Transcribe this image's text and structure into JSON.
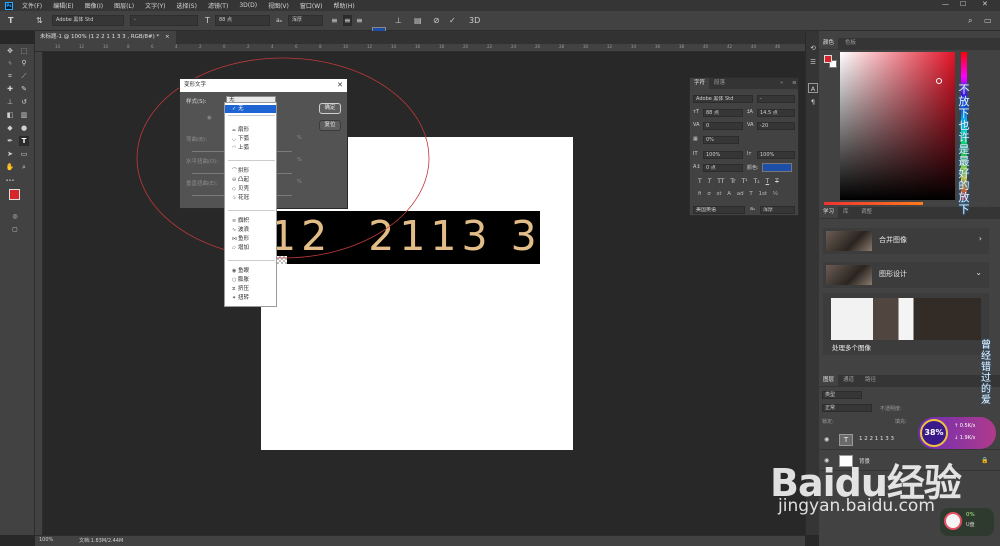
{
  "menubar": {
    "logo": "Ps",
    "items": [
      "文件(F)",
      "编辑(E)",
      "图像(I)",
      "图层(L)",
      "文字(Y)",
      "选择(S)",
      "滤镜(T)",
      "3D(D)",
      "视图(V)",
      "窗口(W)",
      "帮助(H)"
    ],
    "minimize": "—",
    "maximize": "☐",
    "close": "✕"
  },
  "options": {
    "font_family": "Adobe 黑体 Std",
    "font_style": "-",
    "font_size": "88 点",
    "antialias": "浑厚"
  },
  "document": {
    "tab_title": "未标题-1 @ 100% (1 2    2 1 1  3 3 , RGB/8#) *",
    "text_layer_content": "12  2113 3"
  },
  "ruler": {
    "top_numbers": [
      "14",
      "12",
      "10",
      "8",
      "6",
      "4",
      "2",
      "0",
      "2",
      "4",
      "6",
      "8",
      "10",
      "12",
      "14",
      "16",
      "18",
      "20",
      "22",
      "24",
      "26",
      "28",
      "30",
      "32",
      "34",
      "36",
      "38",
      "40",
      "42",
      "44",
      "46"
    ]
  },
  "statusbar": {
    "zoom": "100%",
    "doc_info": "文档:1.83M/2.44M"
  },
  "warp_dialog": {
    "title": "变形文字",
    "style_label": "样式(S):",
    "style_value": "无",
    "ok": "确定",
    "reset": "复位",
    "horizontal": "水平(H)",
    "vertical": "垂直(V)",
    "bend_label": "弯曲(B):",
    "hdist_label": "水平扭曲(O):",
    "vdist_label": "垂直扭曲(E):",
    "percent": "%",
    "style_options": [
      {
        "label": "无",
        "glyph": "✓"
      },
      {
        "label": "扇形",
        "glyph": "⌓"
      },
      {
        "label": "下弧",
        "glyph": "◡"
      },
      {
        "label": "上弧",
        "glyph": "◠"
      },
      {
        "label": "拱形",
        "glyph": "⌒"
      },
      {
        "label": "凸起",
        "glyph": "⊖"
      },
      {
        "label": "贝壳",
        "glyph": "◇"
      },
      {
        "label": "花冠",
        "glyph": "♧"
      },
      {
        "label": "旗帜",
        "glyph": "≋"
      },
      {
        "label": "波浪",
        "glyph": "∿"
      },
      {
        "label": "鱼形",
        "glyph": "⋈"
      },
      {
        "label": "增加",
        "glyph": "▱"
      },
      {
        "label": "鱼眼",
        "glyph": "◉"
      },
      {
        "label": "膨胀",
        "glyph": "○"
      },
      {
        "label": "挤压",
        "glyph": "⧖"
      },
      {
        "label": "扭转",
        "glyph": "✦"
      }
    ]
  },
  "char_panel": {
    "tab_char": "字符",
    "tab_para": "段落",
    "font_family": "Adobe 黑体 Std",
    "font_style": "-",
    "size": "88 点",
    "leading": "14.5 点",
    "kerning": "0",
    "tracking": "-20",
    "scale_pct": "0%",
    "vscale": "100%",
    "hscale": "100%",
    "baseline": "0 点",
    "color_label": "颜色:",
    "lang": "美国英语",
    "aa": "浑厚",
    "styles": [
      "T",
      "T",
      "TT",
      "Tr",
      "T¹",
      "T₁",
      "T",
      "T"
    ],
    "features": [
      "fi",
      "σ",
      "st",
      "A",
      "ad",
      "T",
      "1st",
      "½"
    ]
  },
  "panels": {
    "color_tab": "颜色",
    "swatches_tab": "色板",
    "learn_tab": "学习",
    "lib_tab": "库",
    "adjust_tab": "调整",
    "learn_cards": [
      {
        "title": "合并图像",
        "chevron": "›"
      },
      {
        "title": "图形设计",
        "chevron": "⌄"
      }
    ],
    "learn_big_title": "处理多个图像",
    "layers_tab": "图层",
    "channels_tab": "通道",
    "paths_tab": "路径",
    "layer_filter": "类型",
    "blend_mode": "正常",
    "opacity_label": "不透明度:",
    "lock_label": "锁定:",
    "fill_label": "填充:",
    "layers": [
      {
        "name": "1 2  2 1 1  3 3",
        "thumb": "T"
      },
      {
        "name": "背景",
        "thumb": ""
      }
    ]
  },
  "overlays": {
    "lyric_1": "不放下也许是最好的放下",
    "lyric_2": "曾经错过的爱",
    "perf_pct": "38%",
    "perf_up": "0.5K/s",
    "perf_down": "1.9K/s",
    "wm_baidu": "Baidu经验",
    "wm_url": "jingyan.baidu.com",
    "mini_pct": "0%",
    "mini_label": "U盘"
  }
}
